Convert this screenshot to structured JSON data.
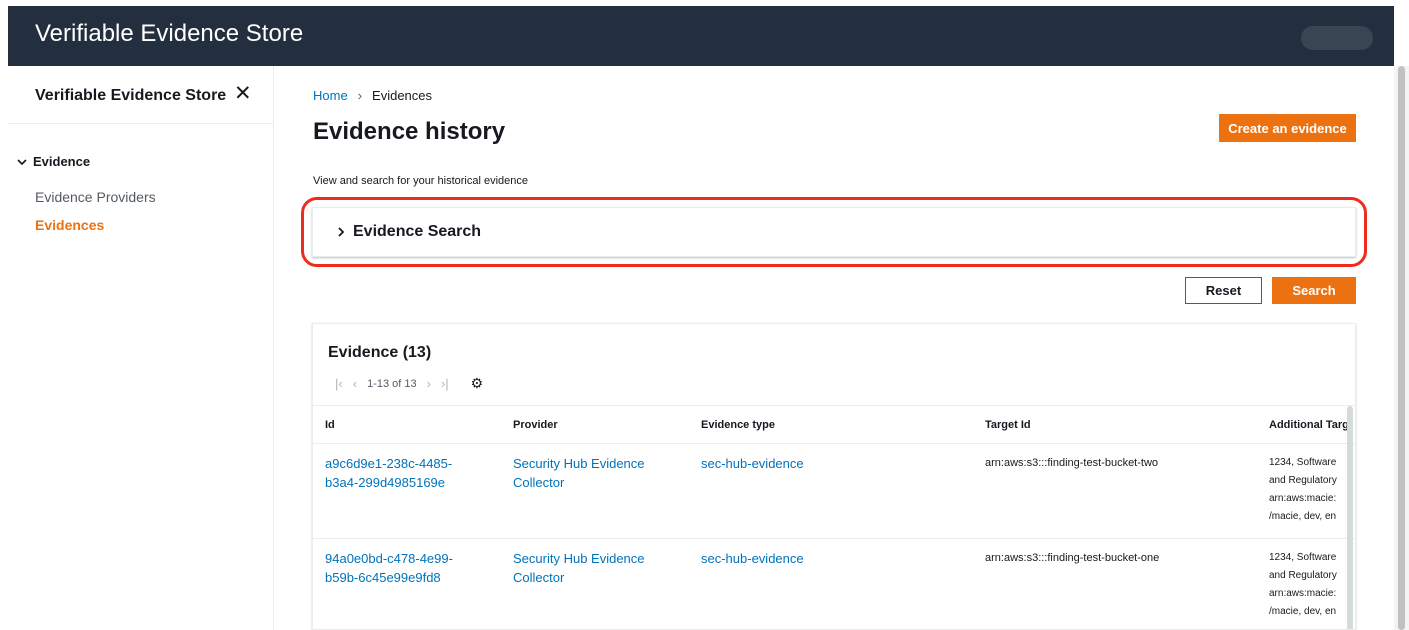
{
  "header": {
    "app_title": "Verifiable Evidence Store"
  },
  "sidenav": {
    "title": "Verifiable Evidence Store",
    "close_icon": "close-icon",
    "section_label": "Evidence",
    "items": [
      {
        "label": "Evidence Providers",
        "active": false
      },
      {
        "label": "Evidences",
        "active": true
      }
    ]
  },
  "breadcrumb": {
    "home": "Home",
    "current": "Evidences"
  },
  "page": {
    "title": "Evidence history",
    "description": "View and search for your historical evidence",
    "create_button": "Create an evidence"
  },
  "search_panel": {
    "label": "Evidence Search"
  },
  "actions": {
    "reset": "Reset",
    "search": "Search"
  },
  "table": {
    "title": "Evidence (13)",
    "pagination": {
      "range": "1-13 of 13"
    },
    "columns": [
      "Id",
      "Provider",
      "Evidence type",
      "Target Id",
      "Additional Targ"
    ],
    "rows": [
      {
        "id_line1": "a9c6d9e1-238c-4485-",
        "id_line2": "b3a4-299d4985169e",
        "provider_line1": "Security Hub Evidence",
        "provider_line2": "Collector",
        "evidence_type": "sec-hub-evidence",
        "target_id": "arn:aws:s3:::finding-test-bucket-two",
        "additional": [
          "1234, Software",
          "and Regulatory",
          "arn:aws:macie:",
          "/macie, dev, en"
        ]
      },
      {
        "id_line1": "94a0e0bd-c478-4e99-",
        "id_line2": "b59b-6c45e99e9fd8",
        "provider_line1": "Security Hub Evidence",
        "provider_line2": "Collector",
        "evidence_type": "sec-hub-evidence",
        "target_id": "arn:aws:s3:::finding-test-bucket-one",
        "additional": [
          "1234, Software",
          "and Regulatory",
          "arn:aws:macie:",
          "/macie, dev, en"
        ]
      }
    ]
  },
  "colors": {
    "header_bg": "#232f3e",
    "accent": "#ec7211",
    "link": "#0073bb",
    "highlight": "#ee2b1c"
  }
}
